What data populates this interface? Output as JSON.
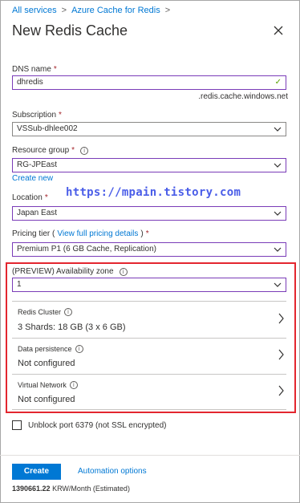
{
  "breadcrumb": [
    {
      "label": "All services"
    },
    {
      "label": "Azure Cache for Redis"
    }
  ],
  "title": "New Redis Cache",
  "dns": {
    "label": "DNS name",
    "value": "dhredis",
    "suffix": ".redis.cache.windows.net"
  },
  "subscription": {
    "label": "Subscription",
    "value": "VSSub-dhlee002"
  },
  "resource_group": {
    "label": "Resource group",
    "value": "RG-JPEast",
    "create_new": "Create new"
  },
  "watermark": "https://mpain.tistory.com",
  "location": {
    "label": "Location",
    "value": "Japan East"
  },
  "pricing": {
    "label_pre": "Pricing tier (",
    "link": "View full pricing details",
    "label_post": ")",
    "value": "Premium P1 (6 GB Cache, Replication)"
  },
  "availability": {
    "label": "(PREVIEW) Availability zone",
    "value": "1"
  },
  "redis_cluster": {
    "label": "Redis Cluster",
    "value": "3 Shards: 18 GB (3 x 6 GB)"
  },
  "data_persistence": {
    "label": "Data persistence",
    "value": "Not configured"
  },
  "virtual_network": {
    "label": "Virtual Network",
    "value": "Not configured"
  },
  "unblock": {
    "label": "Unblock port 6379 (not SSL encrypted)",
    "checked": false
  },
  "footer": {
    "create": "Create",
    "automation": "Automation options",
    "price_amount": "1390661.22",
    "price_suffix": "KRW/Month (Estimated)"
  },
  "colors": {
    "accent": "#0078d4",
    "highlight": "#e3262f",
    "required": "#a4262c",
    "field_border": "#7a3cb8"
  }
}
